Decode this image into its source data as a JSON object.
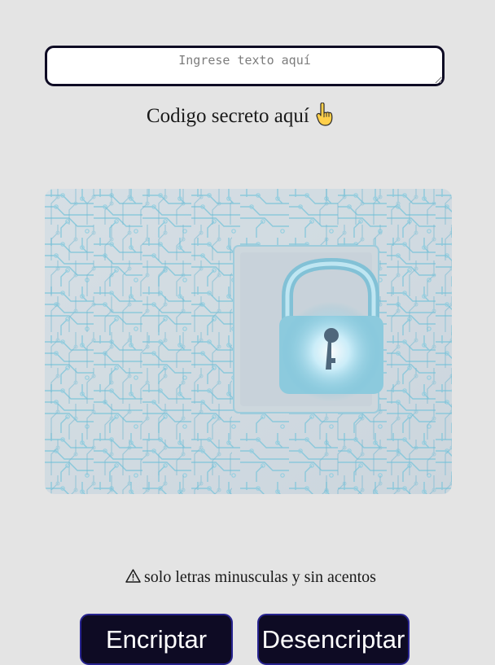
{
  "input": {
    "value": "",
    "placeholder": "Ingrese texto aquí"
  },
  "secret_label": "Codigo secreto aquí",
  "secret_label_icon": "pointing-up-hand-icon",
  "hero_image": {
    "subject": "circuit-board-padlock",
    "colors": {
      "background": "#cfd8df",
      "traces": "#5ab3ce",
      "glow": "#e8fbff"
    }
  },
  "warning": {
    "icon": "warning-icon",
    "text": "solo letras minusculas y sin acentos"
  },
  "buttons": {
    "encrypt": "Encriptar",
    "decrypt": "Desencriptar"
  },
  "colors": {
    "page_background": "#e4e4e4",
    "button_background": "#0e0b24",
    "button_border": "#27238f",
    "button_text": "#ffffff",
    "input_border": "#0e0b24"
  }
}
